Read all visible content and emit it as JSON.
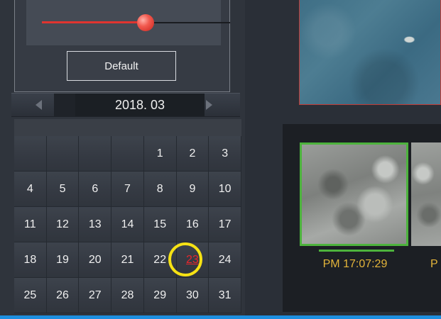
{
  "slider": {
    "value_fraction": 0.55,
    "default_label": "Default"
  },
  "calendar": {
    "month_label": "2018. 03",
    "selected_day": "23",
    "weeks": [
      [
        "",
        "",
        "",
        "",
        "1",
        "2",
        "3"
      ],
      [
        "4",
        "5",
        "6",
        "7",
        "8",
        "9",
        "10"
      ],
      [
        "11",
        "12",
        "13",
        "14",
        "15",
        "16",
        "17"
      ],
      [
        "18",
        "19",
        "20",
        "21",
        "22",
        "23",
        "24"
      ],
      [
        "25",
        "26",
        "27",
        "28",
        "29",
        "30",
        "31"
      ]
    ]
  },
  "thumbnails": [
    {
      "time": "PM 17:07:29",
      "selected": true
    },
    {
      "time": "P",
      "selected": false
    }
  ],
  "colors": {
    "accent_red": "#e8262c",
    "selection_green": "#4db33d",
    "time_text": "#e3b43a",
    "highlight_ring": "#f6e214",
    "bottom_bar": "#1d8fe0"
  }
}
